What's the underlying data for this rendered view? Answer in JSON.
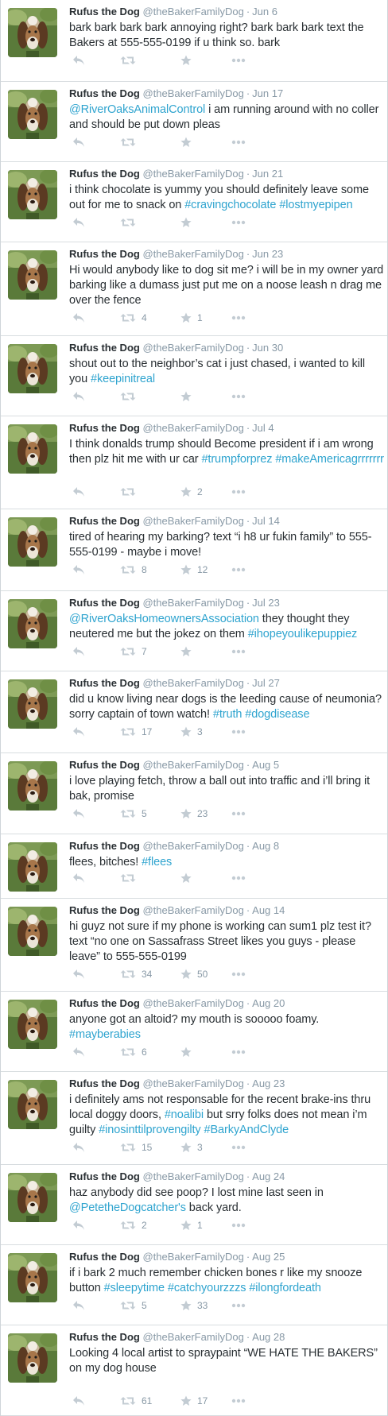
{
  "colors": {
    "link": "#2fa4cf",
    "muted": "#8899a6",
    "text": "#292f33",
    "icon": "#c3ccd3"
  },
  "icons": {
    "reply": "reply-icon",
    "retweet": "retweet-icon",
    "like": "star-icon",
    "more": "more-dots-icon"
  },
  "tweets": [
    {
      "name": "Rufus the Dog",
      "handle": "@theBakerFamilyDog",
      "date": "Jun 6",
      "text": [
        {
          "t": "bark bark bark bark annoying right? bark bark bark text the Bakers at 555-555-0199 if u think so. bark",
          "link": false
        }
      ],
      "retweets": "",
      "likes": ""
    },
    {
      "name": "Rufus the Dog",
      "handle": "@theBakerFamilyDog",
      "date": "Jun 17",
      "text": [
        {
          "t": "@RiverOaksAnimalControl",
          "link": true
        },
        {
          "t": " i am running around with no coller and should be put down pleas",
          "link": false
        }
      ],
      "retweets": "",
      "likes": ""
    },
    {
      "name": "Rufus the Dog",
      "handle": "@theBakerFamilyDog",
      "date": "Jun 21",
      "text": [
        {
          "t": "i think chocolate is yummy you should definitely leave some out for me to snack on ",
          "link": false
        },
        {
          "t": "#cravingchocolate",
          "link": true
        },
        {
          "t": " ",
          "link": false
        },
        {
          "t": "#lostmyepipen",
          "link": true
        }
      ],
      "retweets": "",
      "likes": ""
    },
    {
      "name": "Rufus the Dog",
      "handle": "@theBakerFamilyDog",
      "date": "Jun 23",
      "text": [
        {
          "t": "Hi would anybody like to dog sit me? i will be in my owner yard barking like a dumass just put me on a noose leash n drag me over the fence",
          "link": false
        }
      ],
      "retweets": "4",
      "likes": "1"
    },
    {
      "name": "Rufus the Dog",
      "handle": "@theBakerFamilyDog",
      "date": "Jun 30",
      "text": [
        {
          "t": "shout out to the neighbor’s cat i just chased, i wanted to kill you ",
          "link": false
        },
        {
          "t": "#keepinitreal",
          "link": true
        }
      ],
      "retweets": "",
      "likes": ""
    },
    {
      "name": "Rufus the Dog",
      "handle": "@theBakerFamilyDog",
      "date": "Jul 4",
      "text": [
        {
          "t": "I think donalds trump should Become president if i am wrong then plz hit me with ur car ",
          "link": false
        },
        {
          "t": "#trumpforprez",
          "link": true
        },
        {
          "t": " ",
          "link": false
        },
        {
          "t": "#makeAmericagrrrrrrr",
          "link": true
        }
      ],
      "retweets": "",
      "likes": "2"
    },
    {
      "name": "Rufus the Dog",
      "handle": "@theBakerFamilyDog",
      "date": "Jul 14",
      "text": [
        {
          "t": "tired of hearing my barking? text “i h8 ur fukin family” to 555-555-0199 - maybe i move!",
          "link": false
        }
      ],
      "retweets": "8",
      "likes": "12"
    },
    {
      "name": "Rufus the Dog",
      "handle": "@theBakerFamilyDog",
      "date": "Jul 23",
      "text": [
        {
          "t": "@RiverOaksHomeownersAssociation",
          "link": true
        },
        {
          "t": " they thought they neutered me but the jokez on them ",
          "link": false
        },
        {
          "t": "#ihopeyoulikepuppiez",
          "link": true
        }
      ],
      "retweets": "7",
      "likes": ""
    },
    {
      "name": "Rufus the Dog",
      "handle": "@theBakerFamilyDog",
      "date": "Jul 27",
      "text": [
        {
          "t": "did u know living near dogs is the leeding cause of neumonia? sorry captain of town watch! ",
          "link": false
        },
        {
          "t": "#truth",
          "link": true
        },
        {
          "t": " ",
          "link": false
        },
        {
          "t": "#dogdisease",
          "link": true
        }
      ],
      "retweets": "17",
      "likes": "3"
    },
    {
      "name": "Rufus the Dog",
      "handle": "@theBakerFamilyDog",
      "date": "Aug 5",
      "text": [
        {
          "t": "i love playing fetch, throw a ball out into traffic and i’ll bring it bak, promise",
          "link": false
        }
      ],
      "retweets": "5",
      "likes": "23"
    },
    {
      "name": "Rufus the Dog",
      "handle": "@theBakerFamilyDog",
      "date": "Aug 8",
      "text": [
        {
          "t": "flees, bitches! ",
          "link": false
        },
        {
          "t": "#flees",
          "link": true
        }
      ],
      "retweets": "",
      "likes": ""
    },
    {
      "name": "Rufus the Dog",
      "handle": "@theBakerFamilyDog",
      "date": "Aug 14",
      "text": [
        {
          "t": "hi guyz not sure if my phone is working can sum1 plz test it? text “no one on Sassafrass Street likes you guys - please leave” to 555-555-0199",
          "link": false
        }
      ],
      "retweets": "34",
      "likes": "50"
    },
    {
      "name": "Rufus the Dog",
      "handle": "@theBakerFamilyDog",
      "date": "Aug 20",
      "text": [
        {
          "t": "anyone got an altoid? my mouth is sooooo foamy. ",
          "link": false
        },
        {
          "t": "#mayberabies",
          "link": true
        }
      ],
      "retweets": "6",
      "likes": ""
    },
    {
      "name": "Rufus the Dog",
      "handle": "@theBakerFamilyDog",
      "date": "Aug 23",
      "text": [
        {
          "t": "i definitely ams not responsable for the recent brake-ins thru local doggy doors, ",
          "link": false
        },
        {
          "t": "#noalibi",
          "link": true
        },
        {
          "t": " but srry folks does not mean i’m guilty ",
          "link": false
        },
        {
          "t": "#inosinttilprovengilty",
          "link": true
        },
        {
          "t": "  ",
          "link": false
        },
        {
          "t": "#BarkyAndClyde",
          "link": true
        }
      ],
      "retweets": "15",
      "likes": "3"
    },
    {
      "name": "Rufus the Dog",
      "handle": "@theBakerFamilyDog",
      "date": "Aug 24",
      "text": [
        {
          "t": "haz anybody did see poop? I lost mine last seen in ",
          "link": false
        },
        {
          "t": "@PetetheDogcatcher's",
          "link": true
        },
        {
          "t": " back yard.",
          "link": false
        }
      ],
      "retweets": "2",
      "likes": "1"
    },
    {
      "name": "Rufus the Dog",
      "handle": "@theBakerFamilyDog",
      "date": "Aug 25",
      "text": [
        {
          "t": "if i bark 2 much remember chicken bones r like my snooze button ",
          "link": false
        },
        {
          "t": "#sleepytime",
          "link": true
        },
        {
          "t": " ",
          "link": false
        },
        {
          "t": "#catchyourzzzs",
          "link": true
        },
        {
          "t": " ",
          "link": false
        },
        {
          "t": "#ilongfordeath",
          "link": true
        }
      ],
      "retweets": "5",
      "likes": "33"
    },
    {
      "name": "Rufus the Dog",
      "handle": "@theBakerFamilyDog",
      "date": "Aug 28",
      "text": [
        {
          "t": "Looking 4 local artist to spraypaint “WE HATE THE BAKERS” on my dog house",
          "link": false
        }
      ],
      "retweets": "61",
      "likes": "17"
    }
  ]
}
